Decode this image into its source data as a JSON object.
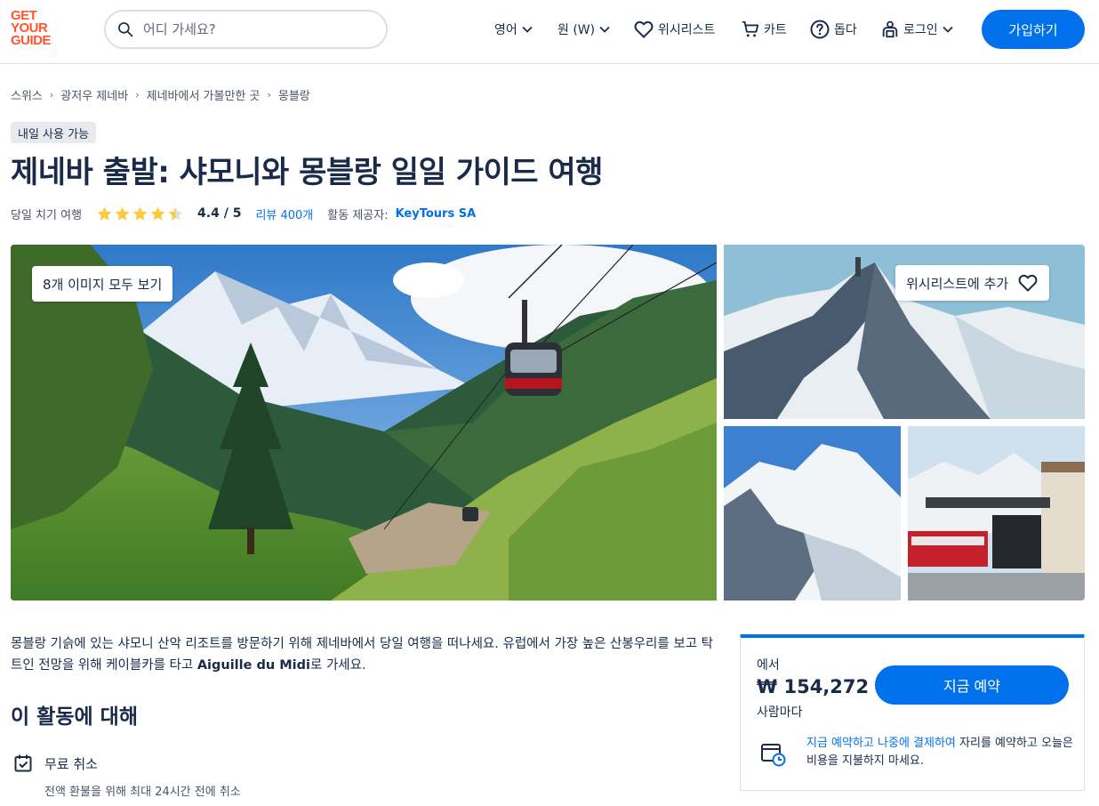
{
  "header": {
    "logo": [
      "GET",
      "YOUR",
      "GUIDE"
    ],
    "search_placeholder": "어디 가세요?",
    "language": "영어",
    "currency": "원 (W)",
    "wishlist": "위시리스트",
    "cart": "카트",
    "help": "돕다",
    "login": "로그인",
    "signup": "가입하기"
  },
  "breadcrumb": [
    "스위스",
    "광저우 제네바",
    "제네바에서 가볼만한 곳",
    "몽블랑"
  ],
  "badge": "내일 사용 가능",
  "title": "제네바 출발: 샤모니와 몽블랑 일일 가이드 여행",
  "meta": {
    "type": "당일 치기 여행",
    "rating": "4.4 / 5",
    "rating_value": 4.4,
    "reviews": "리뷰 400개",
    "provider_label": "활동 제공자:",
    "provider": "KeyTours SA"
  },
  "gallery": {
    "see_all": "8개 이미지 모두 보기",
    "wishlist_add": "위시리스트에 추가"
  },
  "description": {
    "part1": "몽블랑 기슭에 있는 샤모니 산악 리조트를 방문하기 위해 제네바에서 당일 여행을 떠나세요. 유럽에서 가장 높은 산봉우리를 보고 탁 트인 전망을 위해 케이블카를 타고 ",
    "bold": "Aiguille du Midi",
    "part2": "로 가세요."
  },
  "about": {
    "heading": "이 활동에 대해",
    "feature_title": "무료 취소",
    "feature_sub": "전액 환불을 위해 최대 24시간 전에 취소"
  },
  "booking": {
    "from": "에서",
    "price": "₩ 154,272",
    "per": "사람마다",
    "button": "지금 예약",
    "later_highlight": "지금 예약하고 나중에 결제하여",
    "later_rest": " 자리를 예약하고 오늘은 비용을 지불하지 마세요."
  },
  "colors": {
    "brand_orange": "#ff5533",
    "primary_blue": "#0071eb",
    "text_dark": "#1a2b49",
    "star_yellow": "#ffc83d"
  }
}
